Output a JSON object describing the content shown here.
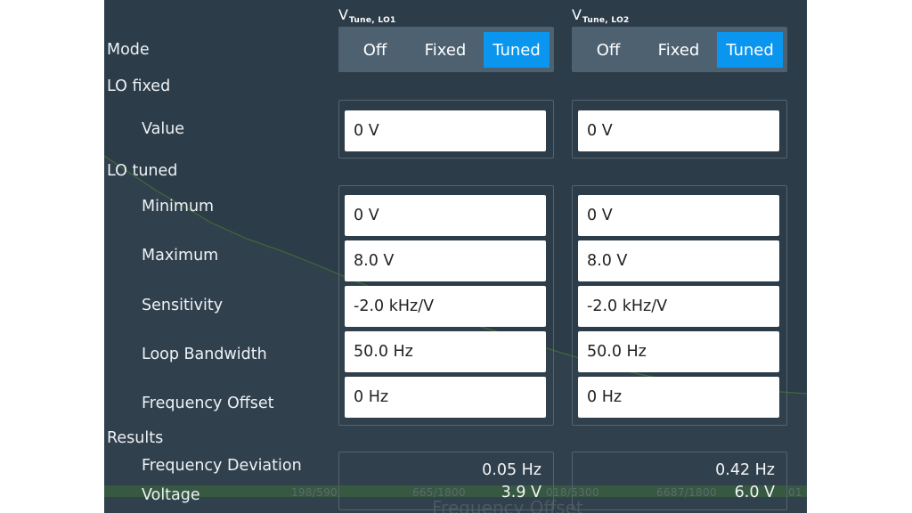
{
  "columns": [
    {
      "symbol": "V",
      "subscript": "Tune, LO1"
    },
    {
      "symbol": "V",
      "subscript": "Tune, LO2"
    }
  ],
  "labels": {
    "mode": "Mode",
    "lo_fixed": "LO fixed",
    "value": "Value",
    "lo_tuned": "LO tuned",
    "minimum": "Minimum",
    "maximum": "Maximum",
    "sensitivity": "Sensitivity",
    "loop_bandwidth": "Loop Bandwidth",
    "frequency_offset": "Frequency Offset",
    "results": "Results",
    "frequency_deviation": "Frequency Deviation",
    "voltage": "Voltage"
  },
  "mode_options": [
    "Off",
    "Fixed",
    "Tuned"
  ],
  "lo1": {
    "mode_selected": "Tuned",
    "value": "0 V",
    "minimum": "0 V",
    "maximum": "8.0 V",
    "sensitivity": "-2.0 kHz/V",
    "loop_bandwidth": "50.0 Hz",
    "frequency_offset": "0 Hz",
    "frequency_deviation": "0.05 Hz",
    "voltage": "3.9 V"
  },
  "lo2": {
    "mode_selected": "Tuned",
    "value": "0 V",
    "minimum": "0 V",
    "maximum": "8.0 V",
    "sensitivity": "-2.0 kHz/V",
    "loop_bandwidth": "50.0 Hz",
    "frequency_offset": "0 Hz",
    "frequency_deviation": "0.42 Hz",
    "voltage": "6.0 V"
  },
  "background": {
    "axis_ticks": [
      "198/590",
      "665/1800",
      "018/5300",
      "6687/1800",
      "01"
    ],
    "axis_title": "Frequency Offset"
  },
  "colors": {
    "panel": "#2d3c49",
    "segment": "#4d6171",
    "active": "#0a96ee",
    "field": "#ffffff",
    "trace": "#3f6a3a"
  }
}
